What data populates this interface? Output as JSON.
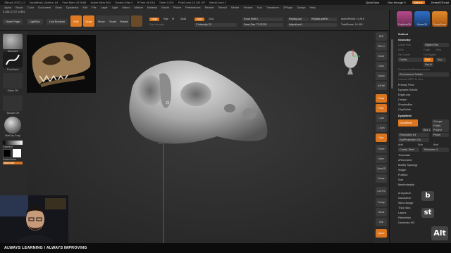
{
  "window": {
    "title": "ZBrush 2023.1.2",
    "document": "DynaMesh_Sphere_64",
    "stats": [
      "Free Mem 15.5068",
      "Active Mem 864",
      "Scratch Disk 0",
      "RTime 46.018",
      "Timer 0.001",
      "PolyCount 15.181 KP",
      "MeshCount 1"
    ],
    "quicksave": "QuickSave",
    "seethrough": "See-through 0",
    "menus_label": "Menus",
    "script": "DefaultZScript"
  },
  "menubar": [
    "Alpha",
    "Brush",
    "Color",
    "Document",
    "Draw",
    "Dynamics",
    "Edit",
    "File",
    "Layer",
    "Light",
    "Macro",
    "Marker",
    "Material",
    "Movie",
    "Picker",
    "Preferences",
    "Render",
    "Stencil",
    "Stroke",
    "Texture",
    "Tool",
    "Transform",
    "ZPlugin",
    "Zscript",
    "Help"
  ],
  "coords": "0.248,-0.727,-0.891",
  "tabs": [
    "Home Page",
    "LightBox",
    "Live Boolean"
  ],
  "toolbar": {
    "tools": [
      "Edit",
      "Draw",
      "Move",
      "Scale",
      "Rotate"
    ],
    "mrgb": "Mrgb",
    "rgb": "Rgb",
    "m": "M",
    "zadd": "Zadd",
    "zsub": "Zsub",
    "zcut": "Zcut",
    "rgb_intensity": "Rgb Intensity",
    "z_intensity": "Z Intensity 23",
    "focal_shift": "Focal Shift 0",
    "draw_size": "Draw Size 77.02378",
    "replay_last": "ReplayLast",
    "replay_last_rel": "ReplayLastRel",
    "adjust_last": "AdjustLast 1",
    "active_points": "ActivePoints: 14,915",
    "total_points": "TotalPoints: 14,915"
  },
  "leftshelf": {
    "brush": "Standard",
    "stroke": "FreeHand",
    "alpha": "Alpha Off",
    "texture": "Texture Off",
    "material": "MatCap Gray",
    "gradient": "Gradient",
    "switch_color": "SwitchColor",
    "alternate": "Alternate"
  },
  "rightstrip": [
    "BPR",
    "SPix 3",
    "Scroll",
    "Zoom",
    "Actual",
    "AAHalf",
    "Persp",
    "Floor",
    "Local",
    "L.Sym",
    "Gxyz",
    "Frame",
    "Move",
    "Zoom3D",
    "Rotate",
    "Line Fill PolyF",
    "Transp",
    "Ghost",
    "Solo",
    "Xpose"
  ],
  "subtool_icons": [
    "PolyMesh3D",
    "Sphere3D",
    "SimpleBrush"
  ],
  "rightpanel": {
    "subtool": "Subtool",
    "geometry": "Geometry",
    "lower_res": "Lower Res",
    "higher_res": "Higher Res",
    "sdiv": "SDiv",
    "cage": "Cage",
    "rstr": "Rstr",
    "del_lower": "Del Lower",
    "del_higher": "Del Higher",
    "freeze": "Freeze SubDivision Levels",
    "reconstruct": "Reconstruct Subdiv",
    "convert": "Convert BPR To Geo",
    "divide": "Divide",
    "smt": "Smt",
    "suv": "Suv",
    "relax": "ReUV",
    "primary": "Primary Pivot",
    "dynamic_subdiv": "Dynamic Subdiv",
    "edgeloop": "EdgeLoop",
    "crease": "Crease",
    "shadowbox": "ShadowBox",
    "claypolish": "ClayPolish",
    "dynamesh_hdr": "DynaMesh",
    "dynamesh_btn": "DynaMesh",
    "groups": "Groups",
    "polish": "Polish",
    "blur": "Blur 2",
    "project": "Project",
    "resolution": "Resolution 64",
    "picker": "Picker",
    "subprojection": "SubProjection 0.6",
    "add": "Add",
    "sub": "Sub",
    "and": "And",
    "create_shell": "Create Shell",
    "thickness": "Thickness 4",
    "tessimate": "Tessimate",
    "zremesher": "ZRemesher",
    "modify_topology": "Modify Topology",
    "stager": "Stager",
    "position": "Position",
    "size": "Size",
    "meshintegrity": "MeshIntegrity",
    "arraymesh": "ArrayMesh",
    "nanomesh": "NanoMesh",
    "slime": "Slime Bridge",
    "thick_skin": "Thick Skin",
    "layers": "Layers",
    "fibermesh": "FiberMesh",
    "geometry_hd": "Geometry HD"
  },
  "keys": {
    "b": "b",
    "st": "st",
    "alt": "Alt"
  },
  "footer": "ALWAYS LEARNING  /  ALWAYS IMPROVING",
  "colors": {
    "accent": "#d9751f",
    "panel": "#262626",
    "viewport": "#2f2f2f"
  }
}
